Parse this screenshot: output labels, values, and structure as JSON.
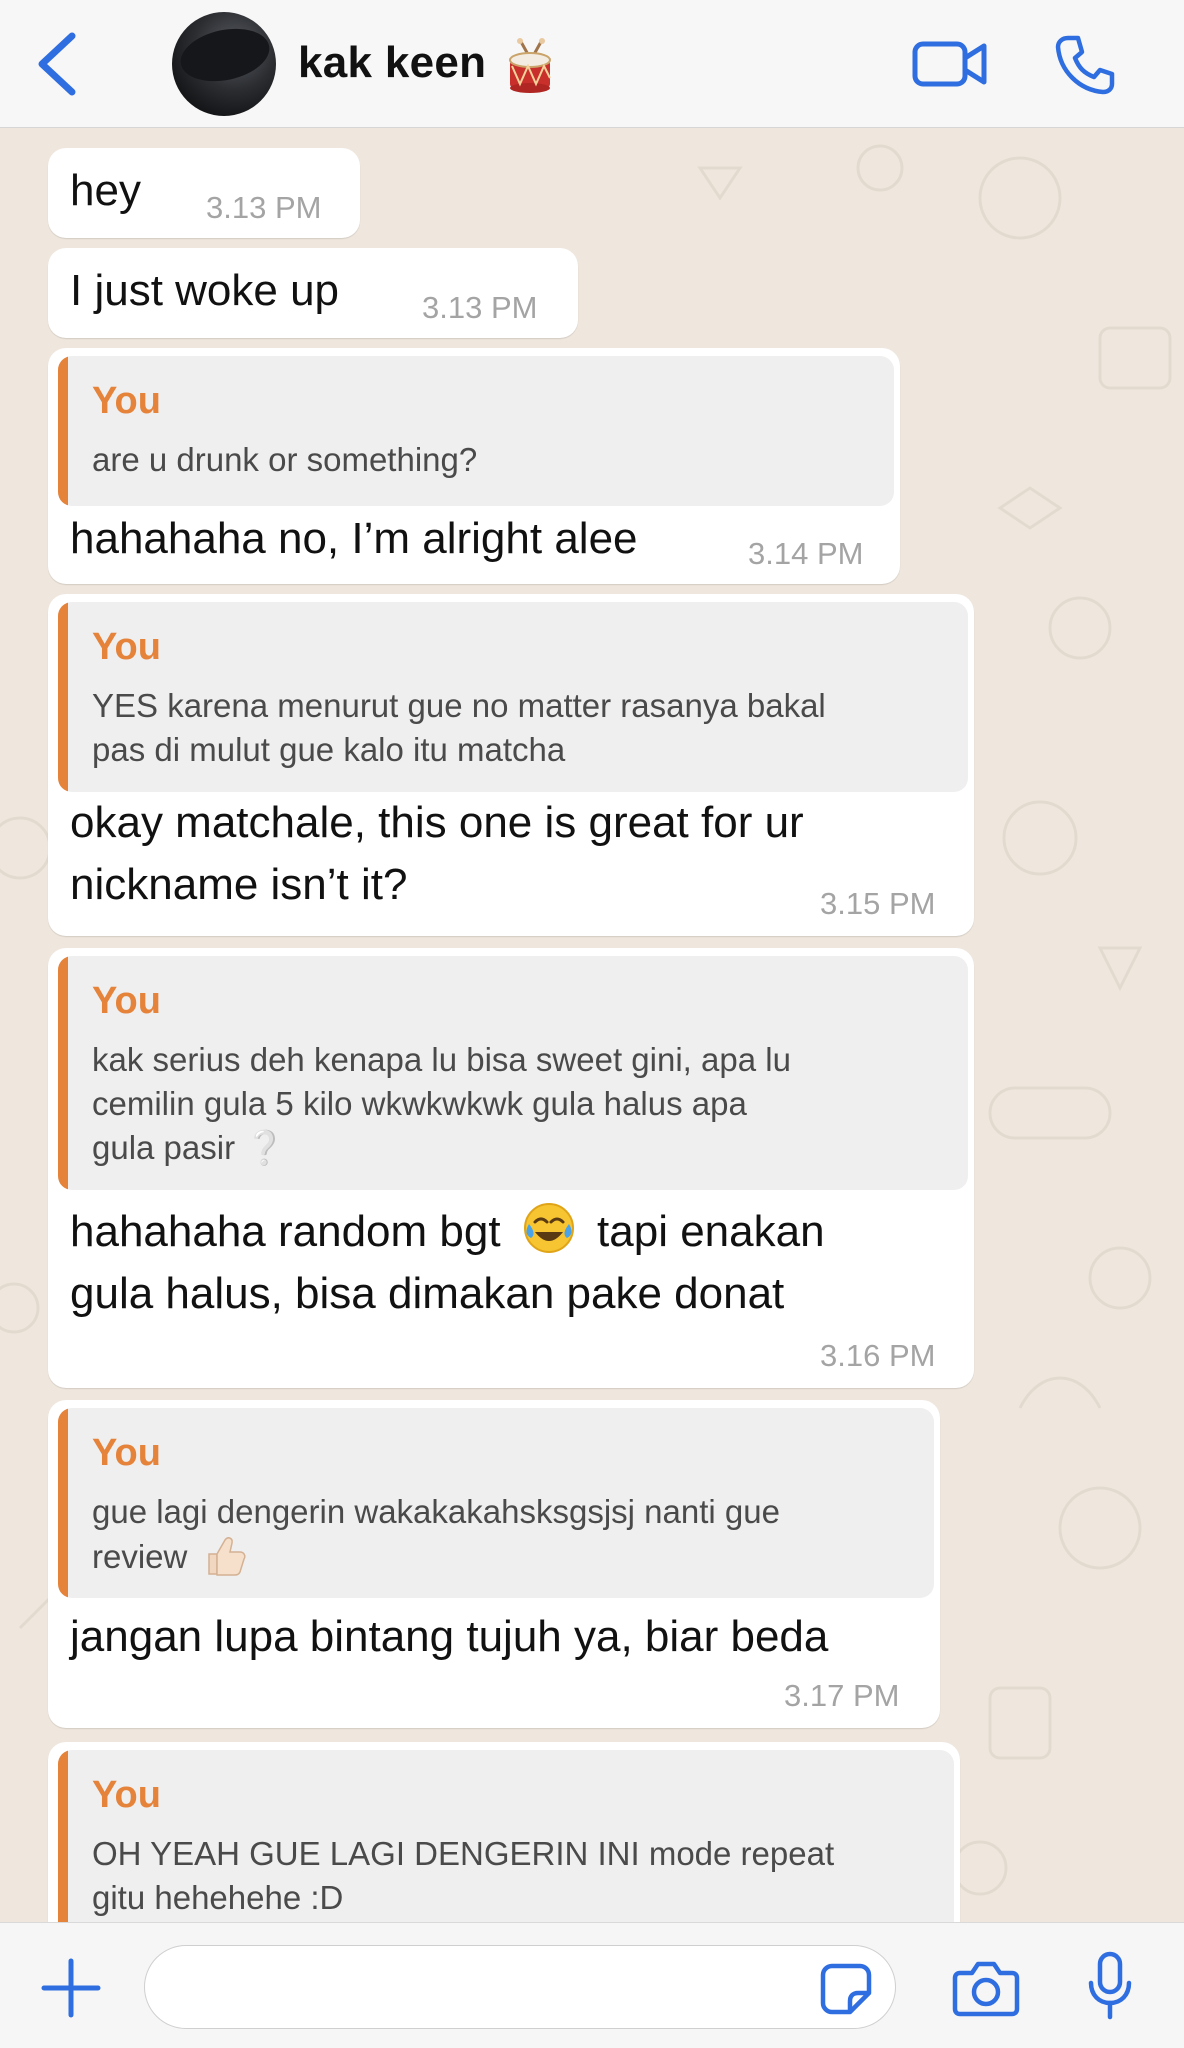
{
  "header": {
    "contact_name": "kak keen",
    "back_icon": "chevron-left-icon",
    "video_icon": "video-camera-icon",
    "call_icon": "phone-icon",
    "accent_color": "#2f6ee0"
  },
  "messages": [
    {
      "text": "hey",
      "time": "3.13 PM"
    },
    {
      "text": "I just woke up",
      "time": "3.13 PM"
    },
    {
      "quote_author": "You",
      "quote_text": "are u drunk or something?",
      "text": "hahahaha no, I’m alright alee",
      "time": "3.14 PM"
    },
    {
      "quote_author": "You",
      "quote_lines": [
        "YES karena menurut gue no matter rasanya bakal",
        "pas di mulut gue kalo itu matcha"
      ],
      "text_lines": [
        "okay matchale, this one is great for ur",
        "nickname isn’t it?"
      ],
      "time": "3.15 PM"
    },
    {
      "quote_author": "You",
      "quote_lines": [
        "kak serius deh kenapa lu bisa sweet gini, apa lu",
        "cemilin gula 5 kilo wkwkwkwk gula halus apa",
        "gula pasir ❔"
      ],
      "text_line1_a": "hahahaha random bgt",
      "text_line1_b": "tapi enakan",
      "text_line2": "gula halus, bisa dimakan pake donat",
      "time": "3.16 PM"
    },
    {
      "quote_author": "You",
      "quote_lines": [
        "gue lagi dengerin wakakakahsksgsjsj nanti gue",
        "review"
      ],
      "text": "jangan lupa bintang tujuh ya, biar beda",
      "time": "3.17 PM"
    },
    {
      "quote_author": "You",
      "quote_lines": [
        "OH YEAH GUE LAGI DENGERIN INI mode repeat",
        "gitu hehehehe :D"
      ]
    }
  ],
  "input_bar": {
    "placeholder": "",
    "icons": [
      "plus-icon",
      "sticker-icon",
      "camera-icon",
      "microphone-icon"
    ]
  },
  "colors": {
    "quote_accent": "#e5833a",
    "wallpaper": "#efe7dd",
    "bubble": "#ffffff"
  }
}
